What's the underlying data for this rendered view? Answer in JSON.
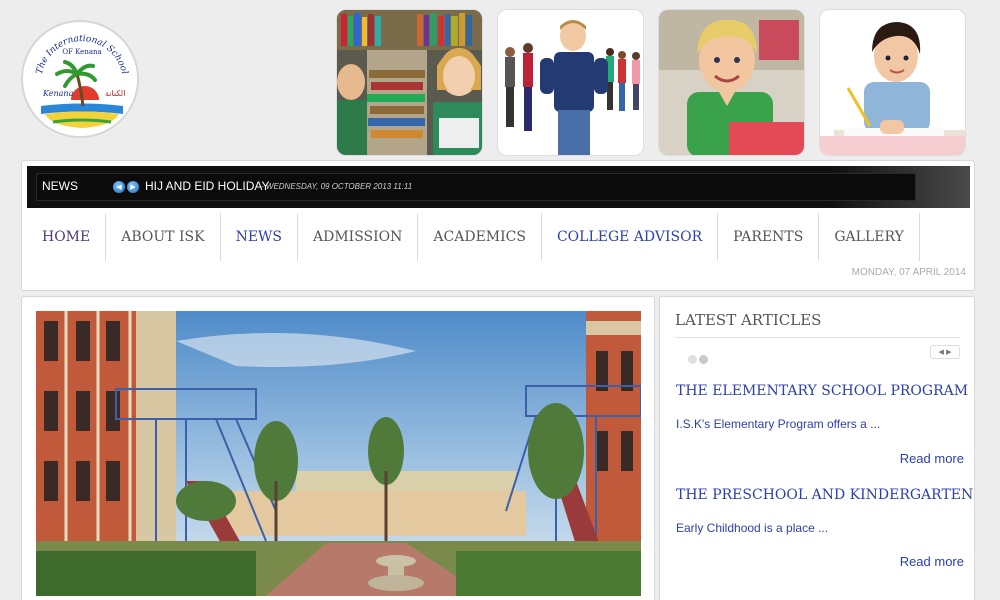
{
  "header": {
    "logo": {
      "top_text": "The International School",
      "sub_text": "OF Kenana",
      "left_text": "Kenana",
      "right_text": "الكنانة"
    },
    "photos": [
      "students-with-books-photo",
      "students-walking-photo",
      "smiling-boy-photo",
      "boy-writing-photo"
    ]
  },
  "ticker": {
    "label": "NEWS",
    "prev_icon": "prev-arrow-icon",
    "next_icon": "next-arrow-icon",
    "title": "HIJ AND EID HOLIDAY",
    "date": "- WEDNESDAY, 09 OCTOBER 2013 11:11"
  },
  "menu": {
    "items": [
      {
        "label": "HOME"
      },
      {
        "label": "ABOUT ISK"
      },
      {
        "label": "NEWS"
      },
      {
        "label": "ADMISSION"
      },
      {
        "label": "ACADEMICS"
      },
      {
        "label": "COLLEGE ADVISOR"
      },
      {
        "label": "PARENTS"
      },
      {
        "label": "GALLERY"
      }
    ]
  },
  "date_line": "MONDAY, 07 APRIL 2014",
  "sidebar": {
    "title": "LATEST ARTICLES",
    "articles": [
      {
        "title": "THE ELEMENTARY SCHOOL PROGRAM",
        "excerpt": "I.S.K's Elementary Program offers a ...",
        "read_more": "Read more"
      },
      {
        "title": "THE PRESCHOOL AND KINDERGARTEN",
        "excerpt": "Early Childhood is a place ...",
        "read_more": "Read more"
      }
    ]
  },
  "colors": {
    "link_blue": "#2c3fb0",
    "ticker_bg": "#101010",
    "page_bg": "#ededed"
  }
}
